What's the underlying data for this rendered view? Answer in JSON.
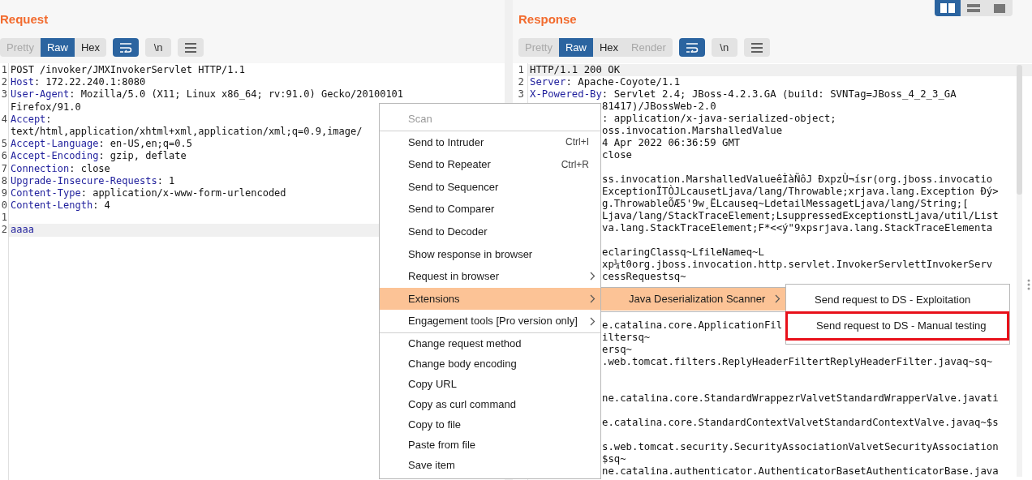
{
  "view_toggles": [
    {
      "kind": "columns",
      "selected": true
    },
    {
      "kind": "rows",
      "selected": false
    },
    {
      "kind": "single",
      "selected": false
    }
  ],
  "panes": [
    {
      "title": "Request",
      "view_tabs": [
        {
          "label": "Pretty",
          "selected": false,
          "disabled": true
        },
        {
          "label": "Raw",
          "selected": true,
          "disabled": false
        },
        {
          "label": "Hex",
          "selected": false,
          "disabled": false
        }
      ],
      "tools": [
        {
          "kind": "wrap",
          "selected": true
        },
        {
          "kind": "text",
          "label": "\\n",
          "selected": false
        },
        {
          "kind": "menu",
          "selected": false
        }
      ],
      "lines": [
        {
          "kind": "text",
          "number": "1",
          "value": "POST /invoker/JMXInvokerServlet HTTP/1.1"
        },
        {
          "kind": "text",
          "number": "2",
          "key": "Host",
          "value": ": 172.22.240.1:8080"
        },
        {
          "kind": "text",
          "number": "3",
          "key": "User-Agent",
          "value": ": Mozilla/5.0 (X11; Linux x86_64; rv:91.0) Gecko/20100101"
        },
        {
          "kind": "text",
          "value": "Firefox/91.0"
        },
        {
          "kind": "text",
          "number": "4",
          "key": "Accept",
          "value": ":"
        },
        {
          "kind": "text",
          "value": "text/html,application/xhtml+xml,application/xml;q=0.9,image/"
        },
        {
          "kind": "text",
          "number": "5",
          "key": "Accept-Language",
          "value": ": en-US,en;q=0.5"
        },
        {
          "kind": "text",
          "number": "6",
          "key": "Accept-Encoding",
          "value": ": gzip, deflate"
        },
        {
          "kind": "text",
          "number": "7",
          "key": "Connection",
          "value": ": close"
        },
        {
          "kind": "text",
          "number": "8",
          "key": "Upgrade-Insecure-Requests",
          "value": ": 1"
        },
        {
          "kind": "text",
          "number": "9",
          "key": "Content-Type",
          "value": ": application/x-www-form-urlencoded"
        },
        {
          "kind": "text",
          "number": "0",
          "key": "Content-Length",
          "value": ": 4"
        },
        {
          "kind": "blank",
          "number": "1"
        },
        {
          "kind": "text",
          "number": "2",
          "key": "aaaa",
          "highlighted": true
        }
      ]
    },
    {
      "title": "Response",
      "view_tabs": [
        {
          "label": "Pretty",
          "selected": false,
          "disabled": true
        },
        {
          "label": "Raw",
          "selected": true,
          "disabled": false
        },
        {
          "label": "Hex",
          "selected": false,
          "disabled": false
        },
        {
          "label": "Render",
          "selected": false,
          "disabled": true
        }
      ],
      "tools": [
        {
          "kind": "wrap",
          "selected": true
        },
        {
          "kind": "text",
          "label": "\\n",
          "selected": false
        },
        {
          "kind": "menu",
          "selected": false
        }
      ],
      "lines": [
        {
          "kind": "text",
          "number": "1",
          "value": "HTTP/1.1 200 OK",
          "highlighted": true
        },
        {
          "kind": "text",
          "number": "2",
          "key": "Server",
          "value": ": Apache-Coyote/1.1"
        },
        {
          "kind": "text",
          "number": "3",
          "key": "X-Powered-By",
          "value": ": Servlet 2.4; JBoss-4.2.3.GA (build: SVNTag=JBoss_4_2_3_GA"
        },
        {
          "kind": "covered",
          "value": "81417)/JBossWeb-2.0"
        },
        {
          "kind": "covered",
          "value": ": application/x-java-serialized-object;"
        },
        {
          "kind": "covered",
          "value": "oss.invocation.MarshalledValue"
        },
        {
          "kind": "covered",
          "value": "4 Apr 2022 06:36:59 GMT"
        },
        {
          "kind": "covered",
          "value": "close"
        },
        {
          "kind": "blank"
        },
        {
          "kind": "covered",
          "value": "ss.invocation.MarshalledValueêÌàÑôJ ĐxpzÙ¬ísr(org.jboss.invocatio"
        },
        {
          "kind": "covered",
          "value": "ExceptionÏTÒJLcausetLjava/lang/Throwable;xrjava.lang.Exception Đý>"
        },
        {
          "kind": "covered",
          "value": "g.ThrowableÕÆ5'9w¸ËLcauseq~LdetailMessagetLjava/lang/String;["
        },
        {
          "kind": "covered",
          "value": "Ljava/lang/StackTraceElement;LsuppressedExceptionstLjava/util/List"
        },
        {
          "kind": "covered",
          "value": "va.lang.StackTraceElement;F*<<ý\"9xpsrjava.lang.StackTraceElementa"
        },
        {
          "kind": "blank"
        },
        {
          "kind": "covered",
          "value": "eclaringClassq~LfileNameq~L"
        },
        {
          "kind": "covered",
          "value": "xp¼t0org.jboss.invocation.http.servlet.InvokerServlettInvokerServ"
        },
        {
          "kind": "covered",
          "value": "cessRequestsq~"
        },
        {
          "kind": "blank"
        },
        {
          "kind": "blank"
        },
        {
          "kind": "blank"
        },
        {
          "kind": "covered",
          "value": "e.catalina.core.ApplicationFil"
        },
        {
          "kind": "covered",
          "value": "iltersq~"
        },
        {
          "kind": "covered",
          "value": "ersq~"
        },
        {
          "kind": "covered",
          "value": ".web.tomcat.filters.ReplyHeaderFiltertReplyHeaderFilter.javaq~sq~"
        },
        {
          "kind": "blank"
        },
        {
          "kind": "blank"
        },
        {
          "kind": "covered",
          "value": "ne.catalina.core.StandardWrappezrValvetStandardWrapperValve.javati"
        },
        {
          "kind": "blank"
        },
        {
          "kind": "covered",
          "value": "e.catalina.core.StandardContextValvetStandardContextValve.javaq~$s"
        },
        {
          "kind": "blank"
        },
        {
          "kind": "covered",
          "value": "s.web.tomcat.security.SecurityAssociationValvetSecurityAssociation"
        },
        {
          "kind": "covered",
          "value": "$sq~"
        },
        {
          "kind": "covered",
          "value": "ne.catalina.authenticator.AuthenticatorBasetAuthenticatorBase.java"
        }
      ]
    }
  ],
  "context_menu": {
    "items": [
      {
        "kind": "item",
        "label": "Scan",
        "disabled": true
      },
      {
        "kind": "separator"
      },
      {
        "kind": "item",
        "label": "Send to Intruder",
        "shortcut": "Ctrl+I"
      },
      {
        "kind": "item",
        "label": "Send to Repeater",
        "shortcut": "Ctrl+R"
      },
      {
        "kind": "item",
        "label": "Send to Sequencer"
      },
      {
        "kind": "item",
        "label": "Send to Comparer"
      },
      {
        "kind": "item",
        "label": "Send to Decoder"
      },
      {
        "kind": "item",
        "label": "Show response in browser"
      },
      {
        "kind": "item",
        "label": "Request in browser",
        "submenu": true
      },
      {
        "kind": "item",
        "label": "Extensions",
        "submenu": true,
        "selected": true
      },
      {
        "kind": "item",
        "label": "Engagement tools [Pro version only]",
        "submenu": true
      },
      {
        "kind": "separator"
      },
      {
        "kind": "item",
        "label": "Change request method"
      },
      {
        "kind": "item",
        "label": "Change body encoding"
      },
      {
        "kind": "item",
        "label": "Copy URL"
      },
      {
        "kind": "item",
        "label": "Copy as curl command"
      },
      {
        "kind": "item",
        "label": "Copy to file"
      },
      {
        "kind": "item",
        "label": "Paste from file"
      },
      {
        "kind": "item",
        "label": "Save item"
      }
    ]
  },
  "extensions_submenu": {
    "items": [
      {
        "kind": "item",
        "label": "Java Deserialization Scanner",
        "submenu": true,
        "selected": true
      }
    ]
  },
  "scanner_submenu": {
    "items": [
      {
        "kind": "item",
        "label": "Send request to DS - Exploitation",
        "annotated": false
      },
      {
        "kind": "item",
        "label": "Send request to DS - Manual testing",
        "annotated": true
      }
    ]
  }
}
